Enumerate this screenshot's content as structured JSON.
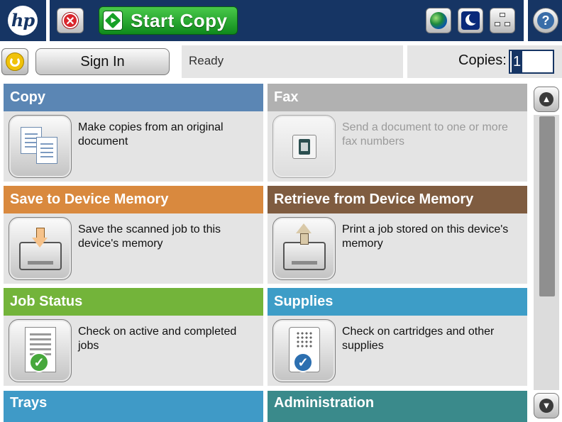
{
  "header": {
    "logo_text": "hp",
    "start_copy_label": "Start Copy",
    "help_label": "?"
  },
  "status": {
    "sign_in_label": "Sign In",
    "status_text": "Ready",
    "copies_label": "Copies:",
    "copies_value": "1"
  },
  "tiles": [
    {
      "title": "Copy",
      "description": "Make copies from an original document",
      "color": "#5b86b4",
      "enabled": true,
      "icon": "copy-icon"
    },
    {
      "title": "Fax",
      "description": "Send a document to one or more fax numbers",
      "color": "#b1b1b1",
      "enabled": false,
      "icon": "fax-icon"
    },
    {
      "title": "Save to Device Memory",
      "description": "Save the scanned job to this device's memory",
      "color": "#d9893e",
      "enabled": true,
      "icon": "save-to-memory-icon"
    },
    {
      "title": "Retrieve from Device Memory",
      "description": "Print a job stored on this device's memory",
      "color": "#7f5c40",
      "enabled": true,
      "icon": "retrieve-from-memory-icon"
    },
    {
      "title": "Job Status",
      "description": "Check on active and completed jobs",
      "color": "#73b43a",
      "enabled": true,
      "icon": "job-status-icon"
    },
    {
      "title": "Supplies",
      "description": "Check on cartridges and other supplies",
      "color": "#3d9dc7",
      "enabled": true,
      "icon": "supplies-icon"
    },
    {
      "title": "Trays",
      "description": "",
      "color": "#3f9ac7",
      "enabled": true,
      "icon": ""
    },
    {
      "title": "Administration",
      "description": "",
      "color": "#3a8a8b",
      "enabled": true,
      "icon": ""
    }
  ],
  "scrollbar": {
    "position": 0.0
  }
}
